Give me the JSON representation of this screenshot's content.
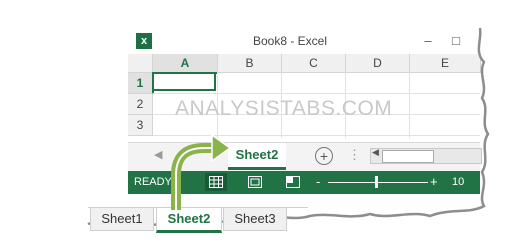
{
  "window": {
    "title": "Book8 - Excel",
    "logo_letter": "x",
    "min_glyph": "–",
    "max_glyph": "□"
  },
  "grid": {
    "columns": [
      "A",
      "B",
      "C",
      "D",
      "E"
    ],
    "rows": [
      "1",
      "2",
      "3"
    ],
    "selected_column": "A",
    "selected_row": "1"
  },
  "watermark": "ANALYSISTABS.COM",
  "tabbar": {
    "left_arrow": "◀",
    "active_tab": "Sheet2",
    "add_glyph": "+",
    "dots": "⋮",
    "scroll_left": "◀"
  },
  "status": {
    "ready": "READY",
    "zoom_minus": "-",
    "zoom_plus": "+",
    "zoom_pct": "10",
    "zoom_level": 0.47
  },
  "big_tabs": [
    "Sheet1",
    "Sheet2",
    "Sheet3"
  ],
  "colors": {
    "excel_green": "#217346",
    "arrow_green": "#8ab34a"
  },
  "icons": [
    "excel-logo-icon",
    "normal-view-icon",
    "page-layout-icon",
    "page-break-icon",
    "add-sheet-icon",
    "curved-arrow-icon"
  ]
}
